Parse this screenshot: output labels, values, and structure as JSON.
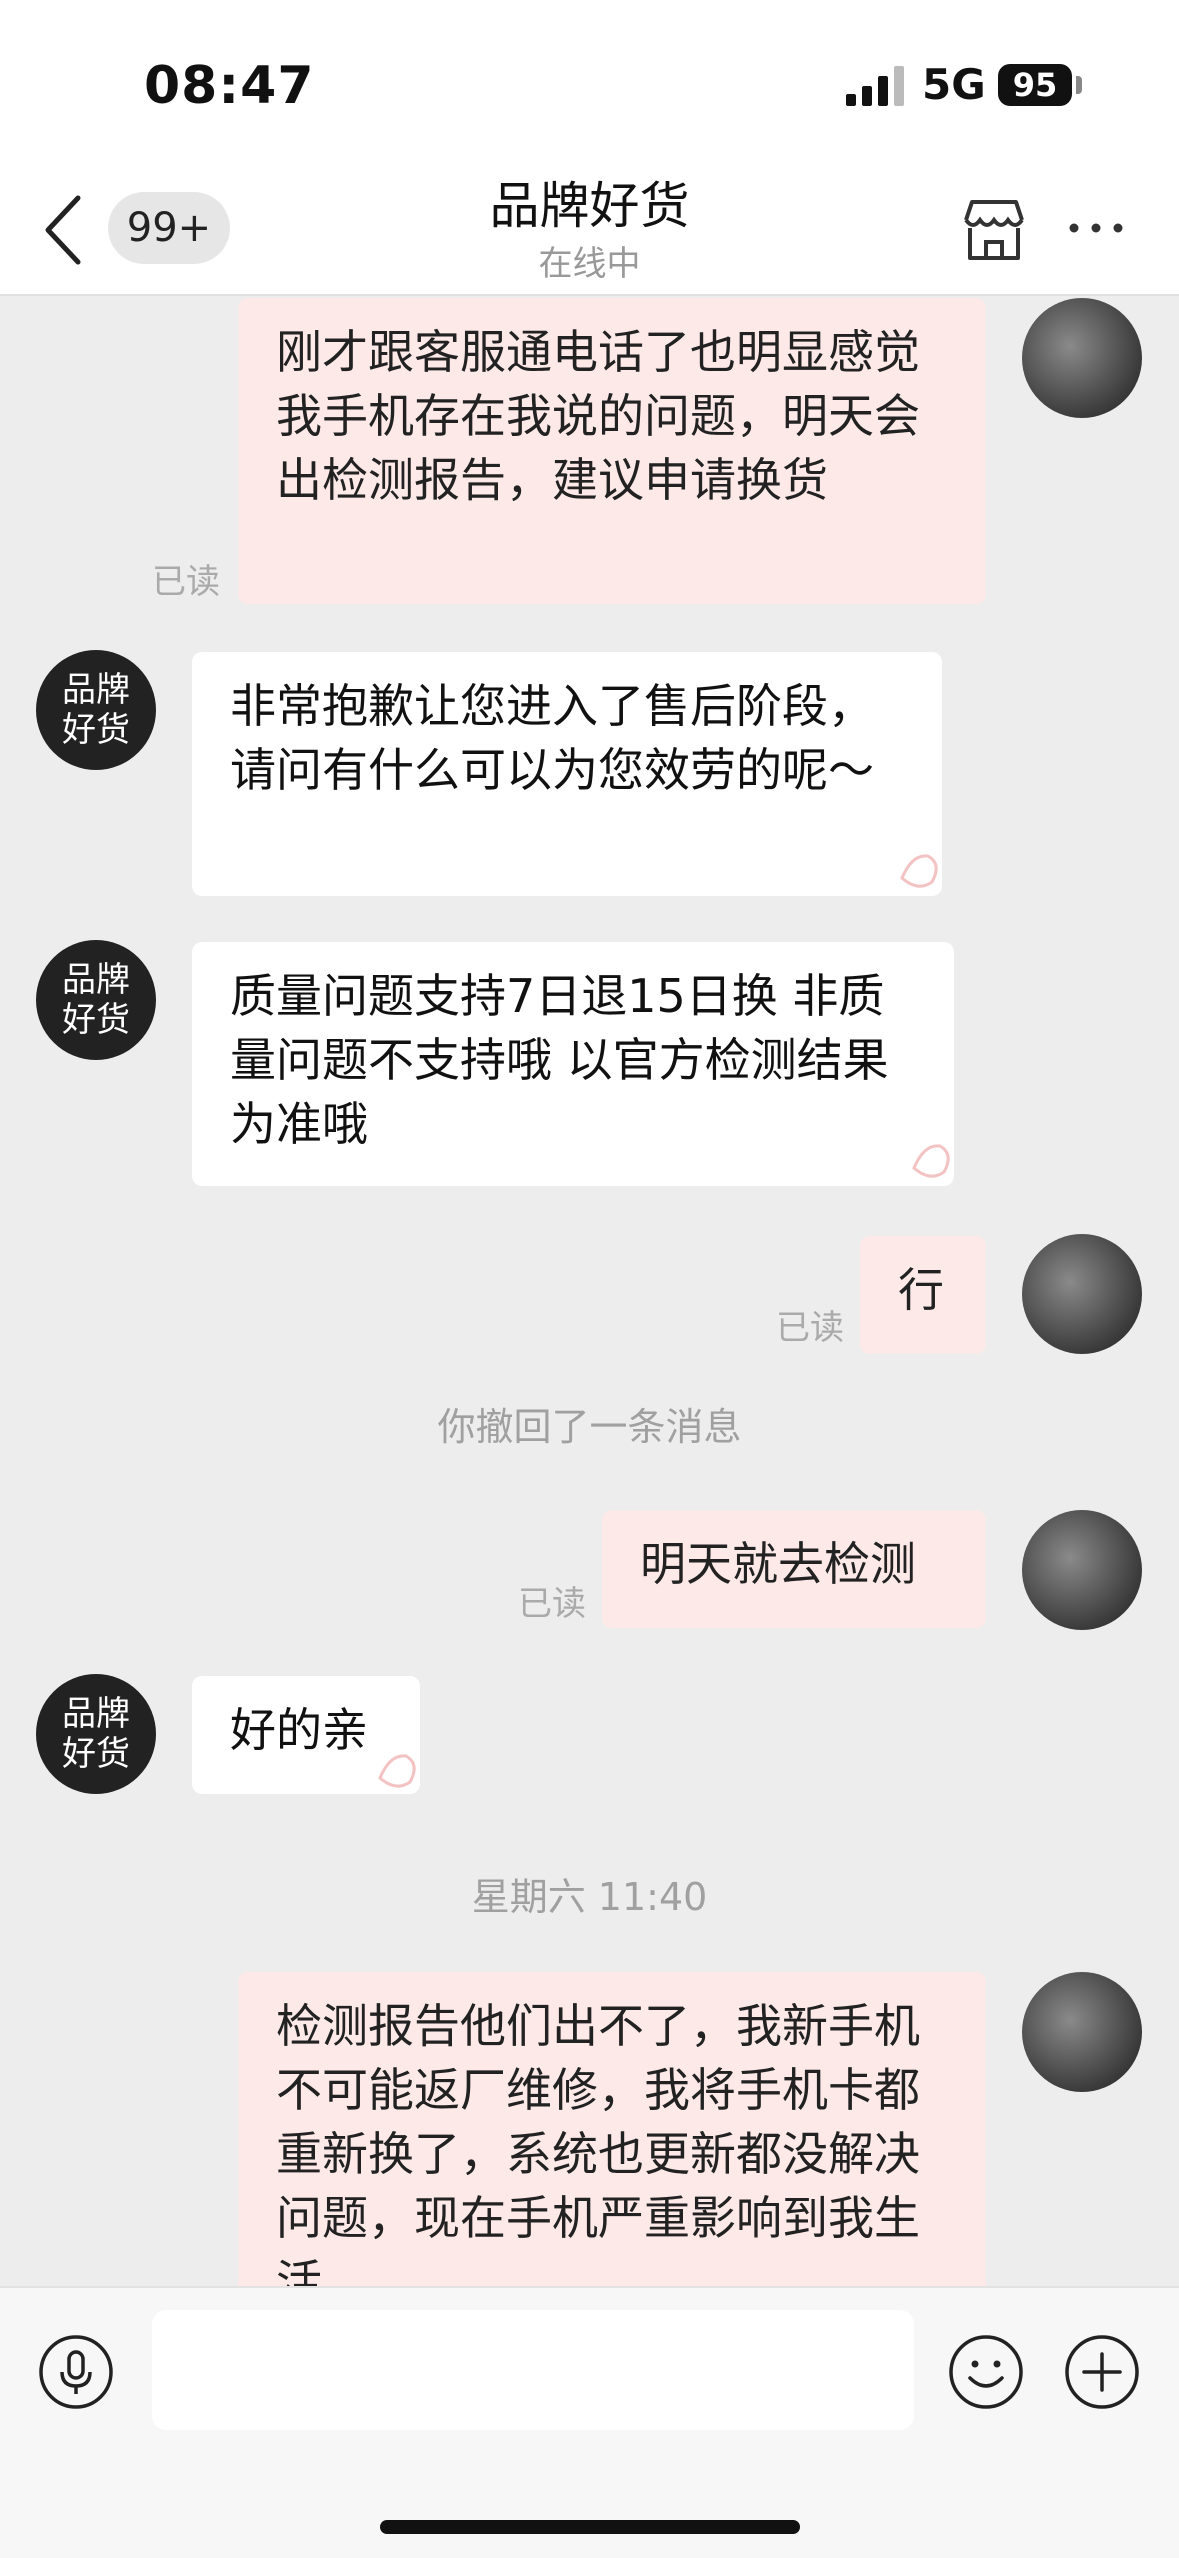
{
  "status_bar": {
    "time": "08:47",
    "network": "5G",
    "battery": "95"
  },
  "header": {
    "back_icon": "chevron-left-icon",
    "unread_badge": "99+",
    "title": "品牌好货",
    "subtitle": "在线中",
    "store_icon": "store-icon",
    "more_icon": "more-icon"
  },
  "chat": {
    "shop_avatar_text_line1": "品牌",
    "shop_avatar_text_line2": "好货",
    "messages": [
      {
        "from": "me",
        "text": "刚才跟客服通电话了也明显感觉我手机存在我说的问题，明天会出检测报告，建议申请换货",
        "read": "已读"
      },
      {
        "from": "shop",
        "text": "非常抱歉让您进入了售后阶段，请问有什么可以为您效劳的呢～"
      },
      {
        "from": "shop",
        "text": "质量问题支持7日退15日换 非质量问题不支持哦 以官方检测结果为准哦"
      },
      {
        "from": "me",
        "text": "行",
        "read": "已读"
      },
      {
        "type": "notice",
        "text": "你撤回了一条消息"
      },
      {
        "from": "me",
        "text": "明天就去检测",
        "read": "已读"
      },
      {
        "from": "shop",
        "text": "好的亲"
      },
      {
        "type": "timestamp",
        "text": "星期六 11:40"
      },
      {
        "from": "me",
        "text": "检测报告他们出不了，我新手机不可能返厂维修，我将手机卡都重新换了，系统也更新都没解决问题，现在手机严重影响到我生活"
      }
    ]
  },
  "input_bar": {
    "voice_icon": "microphone-icon",
    "emoji_icon": "emoji-icon",
    "plus_icon": "plus-icon"
  },
  "colors": {
    "my_bubble": "#fde9e8",
    "shop_bubble": "#ffffff",
    "background": "#ededed"
  }
}
